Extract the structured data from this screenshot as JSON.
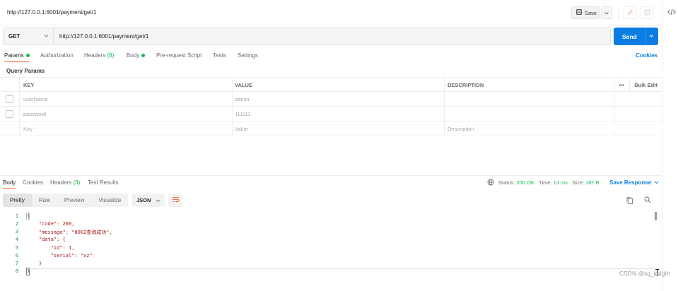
{
  "request": {
    "title": "http://127.0.0.1:6001/payment/get/1",
    "method": "GET",
    "url": "http://127.0.0.1:6001/payment/get/1"
  },
  "toolbar": {
    "save_label": "Save",
    "send_label": "Send"
  },
  "request_tabs": {
    "params": "Params",
    "authorization": "Authorization",
    "headers": "Headers",
    "headers_count": "(8)",
    "body": "Body",
    "prerequest": "Pre-request Script",
    "tests": "Tests",
    "settings": "Settings",
    "cookies": "Cookies"
  },
  "query_params": {
    "title": "Query Params",
    "columns": [
      "KEY",
      "VALUE",
      "DESCRIPTION"
    ],
    "bulk_edit": "Bulk Edit",
    "more": "•••",
    "rows": [
      {
        "key": "userName",
        "value": "admin",
        "description": ""
      },
      {
        "key": "password",
        "value": "111111",
        "description": ""
      }
    ],
    "placeholder": {
      "key": "Key",
      "value": "Value",
      "description": "Description"
    }
  },
  "response_tabs": {
    "body": "Body",
    "cookies": "Cookies",
    "headers": "Headers",
    "headers_count": "(3)",
    "tests": "Test Results"
  },
  "response_status": {
    "status_label": "Status:",
    "status_value": "200 OK",
    "time_label": "Time:",
    "time_value": "13 ms",
    "size_label": "Size:",
    "size_value": "187 B",
    "save_response": "Save Response"
  },
  "view_modes": [
    "Pretty",
    "Raw",
    "Preview",
    "Visualize"
  ],
  "format": "JSON",
  "code_lines": [
    {
      "n": "1",
      "t": "{"
    },
    {
      "n": "2",
      "t": "    \"code\": 200,"
    },
    {
      "n": "3",
      "t": "    \"message\": \"8002查询成功\","
    },
    {
      "n": "4",
      "t": "    \"data\": {"
    },
    {
      "n": "5",
      "t": "        \"id\": 1,"
    },
    {
      "n": "6",
      "t": "        \"serial\": \"xz\""
    },
    {
      "n": "7",
      "t": "    }"
    },
    {
      "n": "8",
      "t": "}"
    }
  ],
  "watermark": "CSDN @sg_knight",
  "colors": {
    "accent": "#ff6c37",
    "send": "#0b7de3",
    "success": "#0cbb52"
  }
}
